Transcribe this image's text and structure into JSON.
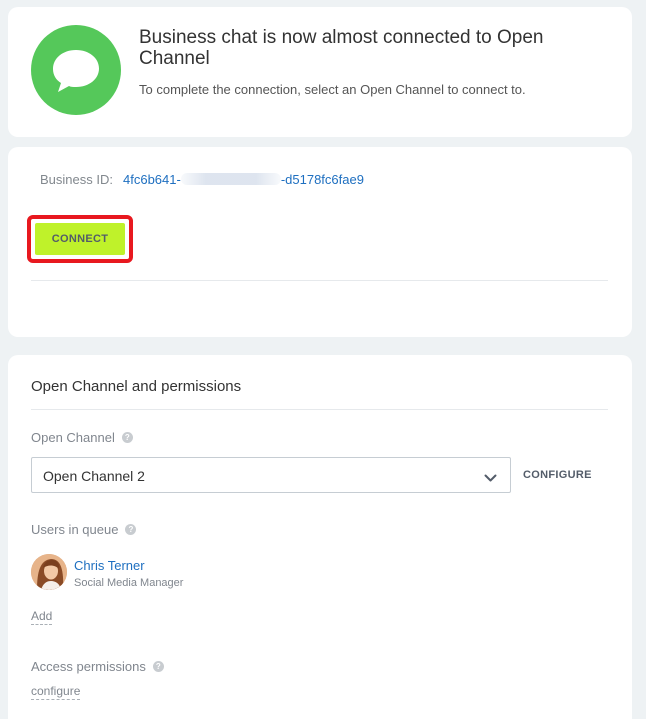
{
  "header": {
    "title": "Business chat is now almost connected to Open Channel",
    "subtitle": "To complete the connection, select an Open Channel to connect to.",
    "icon": "chat-bubble-icon",
    "icon_color": "#55c85a"
  },
  "connect_card": {
    "business_id_label": "Business ID:",
    "business_id_prefix": "4fc6b641-",
    "business_id_suffix": "-d5178fc6fae9",
    "connect_label": "CONNECT",
    "connect_color": "#bff22a",
    "highlight_color": "#e8181f"
  },
  "open_channel": {
    "section_title": "Open Channel and permissions",
    "channel_label": "Open Channel",
    "selected_channel": "Open Channel 2",
    "configure_label": "CONFIGURE",
    "users_label": "Users in queue",
    "users": [
      {
        "name": "Chris Terner",
        "role": "Social Media Manager"
      }
    ],
    "add_label": "Add",
    "access_label": "Access permissions",
    "access_link": "configure"
  }
}
